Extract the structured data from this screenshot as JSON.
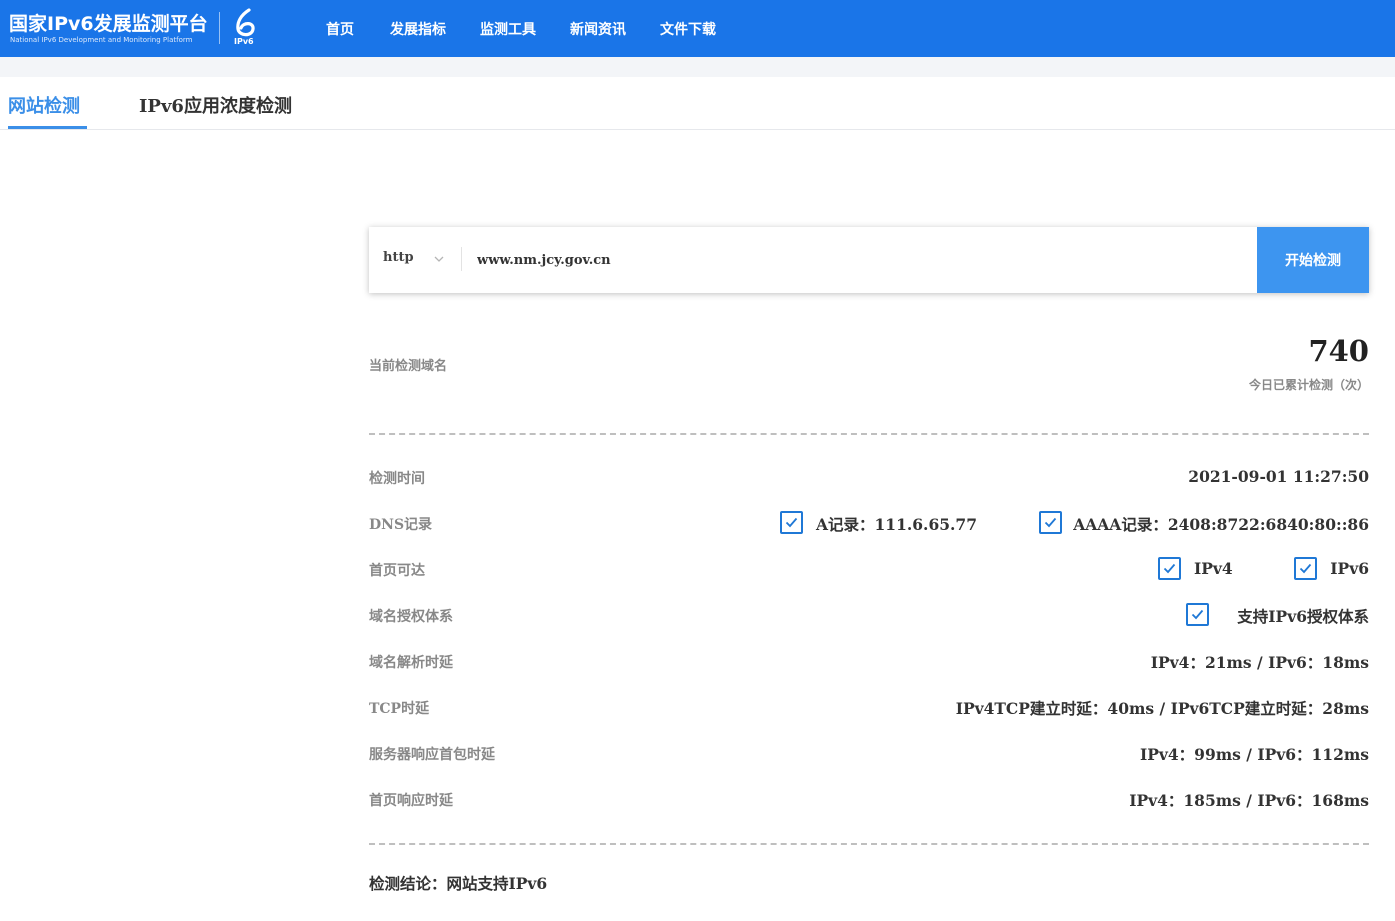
{
  "header": {
    "logo_cn": "国家IPv6发展监测平台",
    "logo_en": "National IPv6 Development and Monitoring Platform",
    "logo_mark_text": "IPv6",
    "nav": [
      "首页",
      "发展指标",
      "监测工具",
      "新闻资讯",
      "文件下载"
    ],
    "bg_color": "#1a75e8"
  },
  "tabs": {
    "active": "网站检测",
    "inactive": "IPv6应用浓度检测",
    "accent_color": "#3b8fe8"
  },
  "search": {
    "protocol": "http",
    "url_value": "www.nm.jcy.gov.cn",
    "button_label": "开始检测",
    "button_color": "#3d95f0"
  },
  "summary": {
    "domain_label": "当前检测域名",
    "count": "740",
    "count_label": "今日已累计检测（次）"
  },
  "results": {
    "time": {
      "label": "检测时间",
      "value": "2021-09-01 11:27:50"
    },
    "dns": {
      "label": "DNS记录",
      "a_record": "A记录：111.6.65.77",
      "aaaa_record": "AAAA记录：2408:8722:6840:80::86"
    },
    "reachable": {
      "label": "首页可达",
      "ipv4": "IPv4",
      "ipv6": "IPv6"
    },
    "auth": {
      "label": "域名授权体系",
      "value": "支持IPv6授权体系"
    },
    "dns_delay": {
      "label": "域名解析时延",
      "value": "IPv4：21ms / IPv6：18ms"
    },
    "tcp_delay": {
      "label": "TCP时延",
      "value": "IPv4TCP建立时延：40ms / IPv6TCP建立时延：28ms"
    },
    "first_packet": {
      "label": "服务器响应首包时延",
      "value": "IPv4：99ms / IPv6：112ms"
    },
    "page_delay": {
      "label": "首页响应时延",
      "value": "IPv4：185ms / IPv6：168ms"
    }
  },
  "conclusion": "检测结论：网站支持IPv6"
}
